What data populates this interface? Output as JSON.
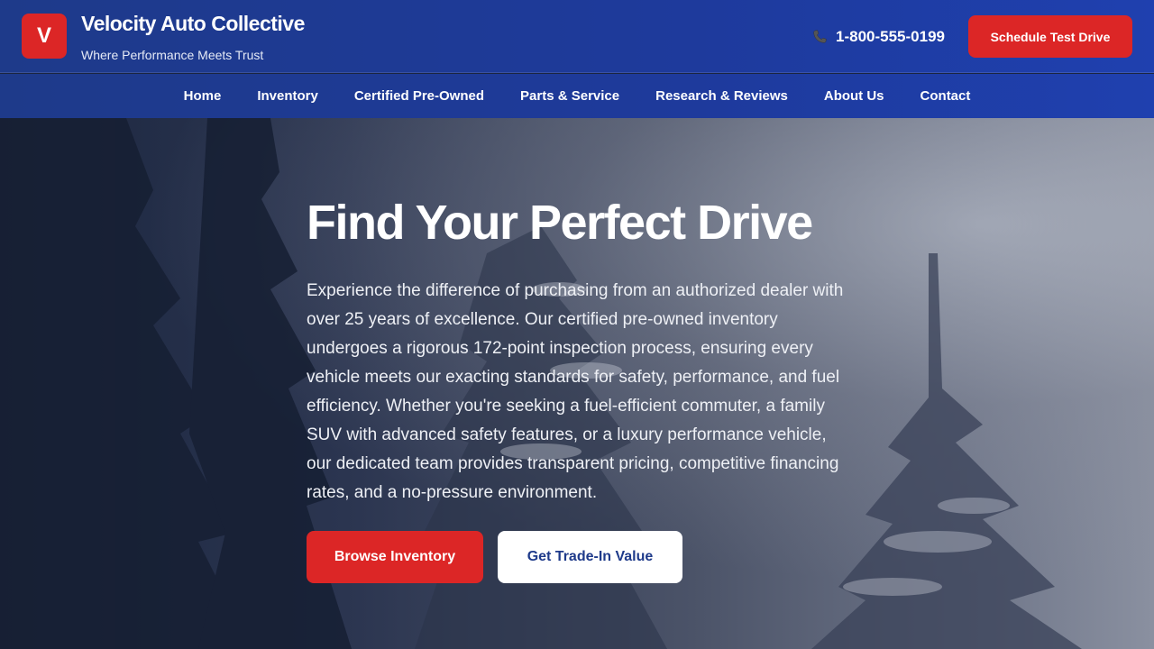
{
  "header": {
    "logo_letter": "V",
    "brand_name": "Velocity Auto Collective",
    "tagline": "Where Performance Meets Trust",
    "phone": "1-800-555-0199",
    "phone_icon": "phone-icon",
    "cta_label": "Schedule Test Drive"
  },
  "nav": {
    "items": [
      {
        "label": "Home"
      },
      {
        "label": "Inventory"
      },
      {
        "label": "Certified Pre-Owned"
      },
      {
        "label": "Parts & Service"
      },
      {
        "label": "Research & Reviews"
      },
      {
        "label": "About Us"
      },
      {
        "label": "Contact"
      }
    ]
  },
  "hero": {
    "title": "Find Your Perfect Drive",
    "text": "Experience the difference of purchasing from an authorized dealer with over 25 years of excellence. Our certified pre-owned inventory undergoes a rigorous 172-point inspection process, ensuring every vehicle meets our exacting standards for safety, performance, and fuel efficiency. Whether you're seeking a fuel-efficient commuter, a family SUV with advanced safety features, or a luxury performance vehicle, our dedicated team provides transparent pricing, competitive financing rates, and a no-pressure environment.",
    "primary_button": "Browse Inventory",
    "secondary_button": "Get Trade-In Value"
  },
  "colors": {
    "brand_blue": "#1e3a8a",
    "accent_red": "#dc2626"
  }
}
